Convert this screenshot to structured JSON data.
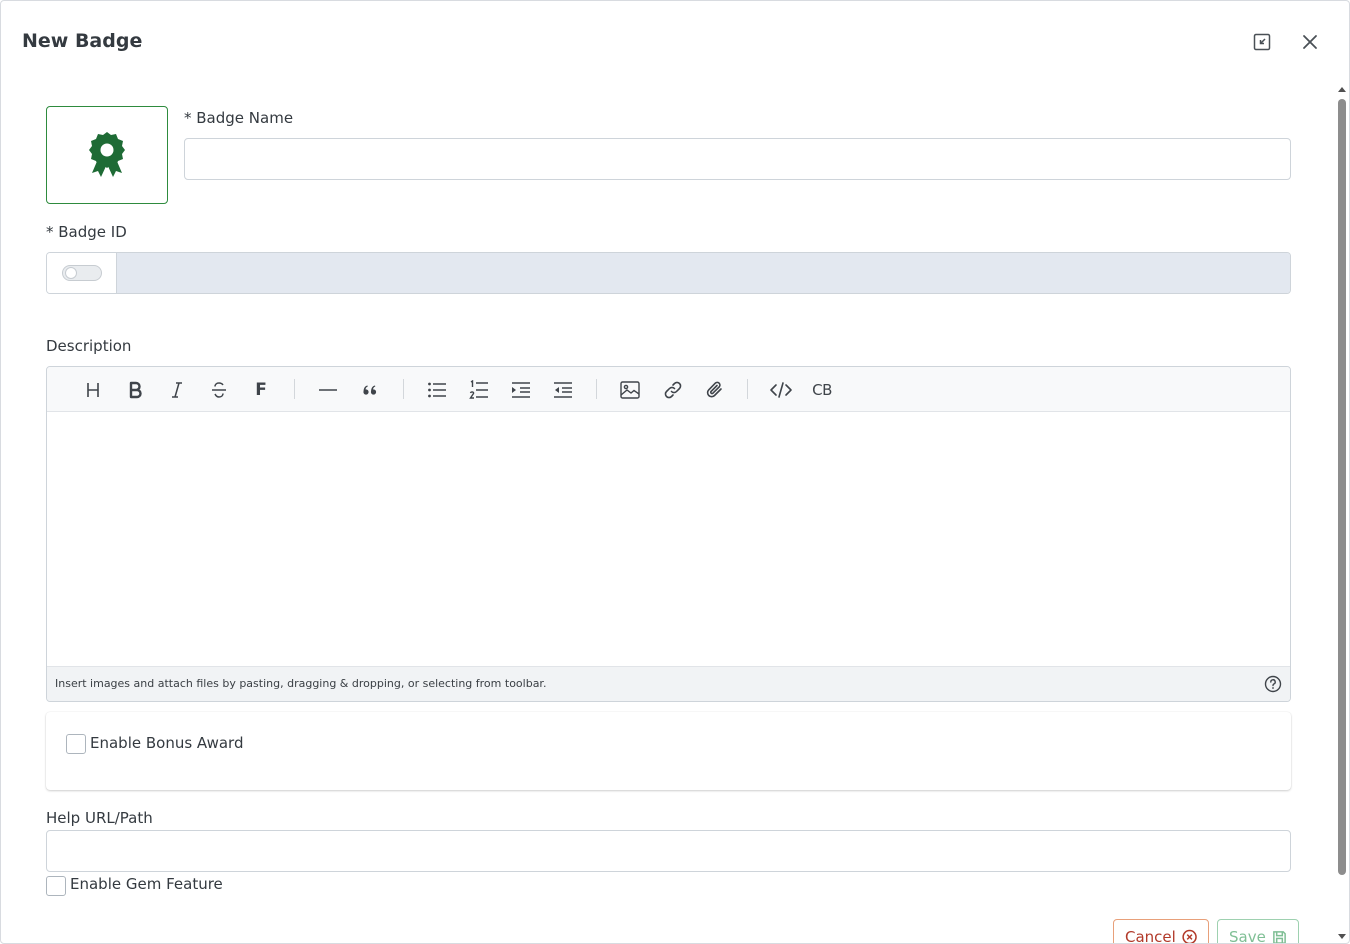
{
  "modal": {
    "title": "New Badge"
  },
  "form": {
    "badge_name_label": "* Badge Name",
    "badge_name_value": "",
    "badge_id_label": "* Badge ID",
    "badge_id_value": "",
    "badge_id_toggle_on": false,
    "description_label": "Description",
    "help_url_label": "Help URL/Path",
    "help_url_value": ""
  },
  "editor": {
    "toolbar": [
      "heading-icon",
      "bold-icon",
      "italic-icon",
      "strikethrough-icon",
      "font-icon",
      "horizontal-rule-icon",
      "quote-icon",
      "bullet-list-icon",
      "numbered-list-icon",
      "indent-icon",
      "outdent-icon",
      "image-icon",
      "link-icon",
      "attach-icon",
      "code-icon",
      "code-block-icon"
    ],
    "content": "",
    "footer_hint": "Insert images and attach files by pasting, dragging & dropping, or selecting from toolbar.",
    "font_button_label": "F",
    "code_block_label": "CB"
  },
  "bonus": {
    "label": "Enable Bonus Award",
    "checked": false
  },
  "gem": {
    "label": "Enable Gem Feature",
    "checked": false
  },
  "actions": {
    "cancel_label": "Cancel",
    "save_label": "Save"
  },
  "colors": {
    "badge_green": "#1e6b35",
    "badge_border": "#2e8b3e",
    "cancel_text": "#b23a2a",
    "save_text": "#7fbf95",
    "id_field_bg": "#e3e8f0"
  }
}
